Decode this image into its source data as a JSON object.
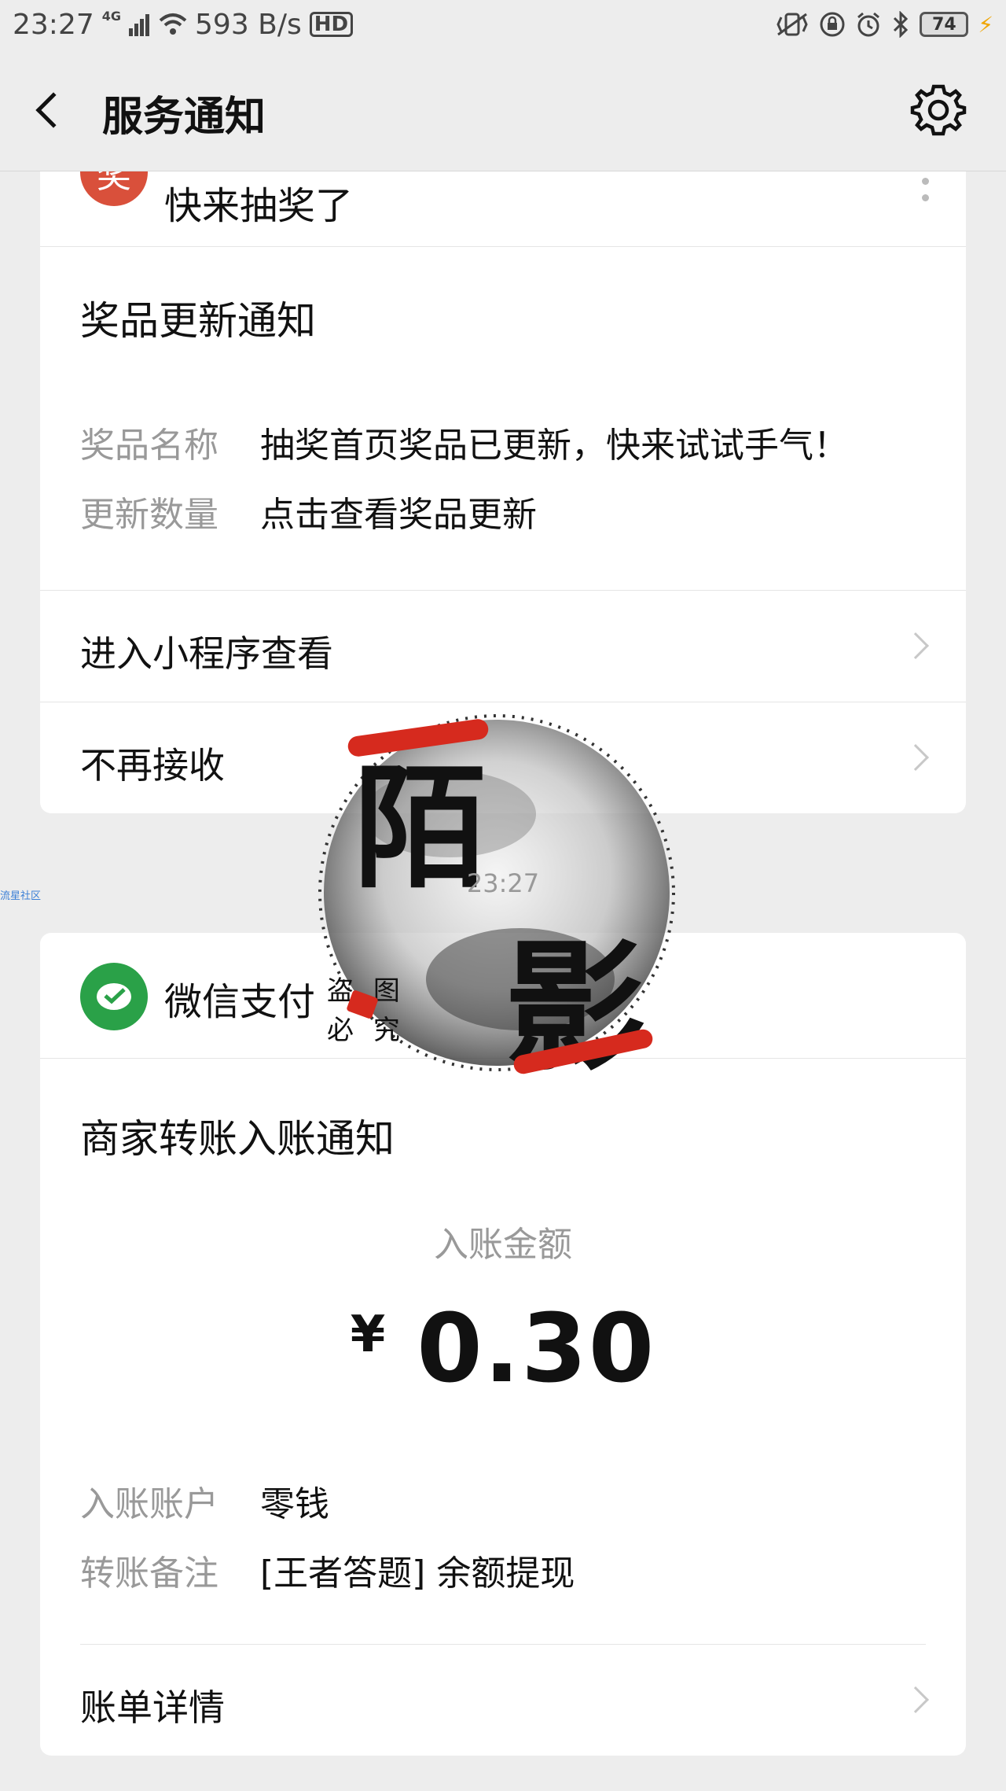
{
  "status_bar": {
    "time": "23:27",
    "network": "4G",
    "speed": "593 B/s",
    "hd": "HD",
    "battery": "74"
  },
  "nav": {
    "title": "服务通知"
  },
  "card1": {
    "source_avatar_text": "奖",
    "source_name": "快来抽奖了",
    "title": "奖品更新通知",
    "fields": [
      {
        "label": "奖品名称",
        "value": "抽奖首页奖品已更新，快来试试手气！"
      },
      {
        "label": "更新数量",
        "value": "点击查看奖品更新"
      }
    ],
    "actions": [
      {
        "label": "进入小程序查看"
      },
      {
        "label": "不再接收"
      }
    ]
  },
  "message_time": "23:27",
  "side_tag": "流星社区",
  "watermark": {
    "big_char_1": "陌",
    "big_char_2": "影",
    "small_chars": [
      "盗",
      "图",
      "必",
      "究"
    ]
  },
  "card2": {
    "source_name": "微信支付",
    "title": "商家转账入账通知",
    "amount_label": "入账金额",
    "currency": "¥",
    "amount": "0.30",
    "fields": [
      {
        "label": "入账账户",
        "value": "零钱"
      },
      {
        "label": "转账备注",
        "value": "[王者答题] 余额提现"
      }
    ],
    "detail_label": "账单详情"
  },
  "colors": {
    "page_bg": "#ededed",
    "card_bg": "#ffffff",
    "lottery_avatar": "#d9503b",
    "wechat_pay_green": "#2aa148",
    "watermark_red": "#d62a1e"
  }
}
